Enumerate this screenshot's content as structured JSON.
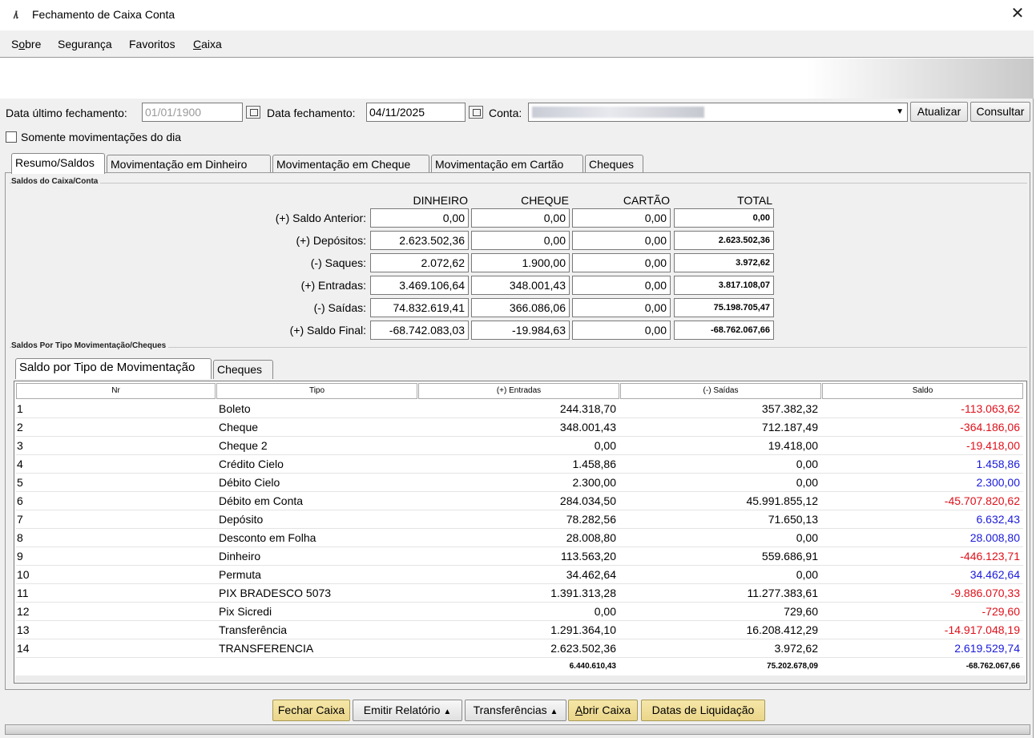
{
  "window": {
    "title": "Fechamento de Caixa Conta",
    "logo": "/\\."
  },
  "menu": [
    {
      "label": "Sobre",
      "underline": "o"
    },
    {
      "label": "Segurança"
    },
    {
      "label": "Favoritos"
    },
    {
      "label": "Caixa",
      "underline": "C"
    }
  ],
  "filters": {
    "data_ultimo_label": "Data último fechamento:",
    "data_ultimo_value": "01/01/1900",
    "data_fechamento_label": "Data fechamento:",
    "data_fechamento_value": "04/11/2025",
    "conta_label": "Conta:",
    "atualizar": "Atualizar",
    "consultar": "Consultar",
    "somente_label": "Somente movimentações do dia"
  },
  "tabs": [
    "Resumo/Saldos",
    "Movimentação em Dinheiro",
    "Movimentação em Cheque",
    "Movimentação em Cartão",
    "Cheques"
  ],
  "saldos": {
    "group_title": "Saldos do Caixa/Conta",
    "columns": [
      "DINHEIRO",
      "CHEQUE",
      "CARTÃO",
      "TOTAL"
    ],
    "rows": [
      {
        "label": "(+) Saldo Anterior:",
        "values": [
          "0,00",
          "0,00",
          "0,00",
          "0,00"
        ]
      },
      {
        "label": "(+) Depósitos:",
        "values": [
          "2.623.502,36",
          "0,00",
          "0,00",
          "2.623.502,36"
        ]
      },
      {
        "label": "(-) Saques:",
        "values": [
          "2.072,62",
          "1.900,00",
          "0,00",
          "3.972,62"
        ]
      },
      {
        "label": "(+) Entradas:",
        "values": [
          "3.469.106,64",
          "348.001,43",
          "0,00",
          "3.817.108,07"
        ]
      },
      {
        "label": "(-) Saídas:",
        "values": [
          "74.832.619,41",
          "366.086,06",
          "0,00",
          "75.198.705,47"
        ]
      },
      {
        "label": "(+) Saldo Final:",
        "values": [
          "-68.742.083,03",
          "-19.984,63",
          "0,00",
          "-68.762.067,66"
        ]
      }
    ]
  },
  "tipo": {
    "group_title": "Saldos Por Tipo Movimentação/Cheques",
    "subtabs": [
      "Saldo por Tipo de Movimentação",
      "Cheques"
    ],
    "headers": [
      "Nr",
      "Tipo",
      "(+) Entradas",
      "(-) Saídas",
      "Saldo"
    ],
    "rows": [
      {
        "nr": "1",
        "tipo": "Boleto",
        "entradas": "244.318,70",
        "saidas": "357.382,32",
        "saldo": "-113.063,62"
      },
      {
        "nr": "2",
        "tipo": "Cheque",
        "entradas": "348.001,43",
        "saidas": "712.187,49",
        "saldo": "-364.186,06"
      },
      {
        "nr": "3",
        "tipo": "Cheque 2",
        "entradas": "0,00",
        "saidas": "19.418,00",
        "saldo": "-19.418,00"
      },
      {
        "nr": "4",
        "tipo": "Crédito Cielo",
        "entradas": "1.458,86",
        "saidas": "0,00",
        "saldo": "1.458,86"
      },
      {
        "nr": "5",
        "tipo": "Débito Cielo",
        "entradas": "2.300,00",
        "saidas": "0,00",
        "saldo": "2.300,00"
      },
      {
        "nr": "6",
        "tipo": "Débito em Conta",
        "entradas": "284.034,50",
        "saidas": "45.991.855,12",
        "saldo": "-45.707.820,62"
      },
      {
        "nr": "7",
        "tipo": "Depósito",
        "entradas": "78.282,56",
        "saidas": "71.650,13",
        "saldo": "6.632,43"
      },
      {
        "nr": "8",
        "tipo": "Desconto em Folha",
        "entradas": "28.008,80",
        "saidas": "0,00",
        "saldo": "28.008,80"
      },
      {
        "nr": "9",
        "tipo": "Dinheiro",
        "entradas": "113.563,20",
        "saidas": "559.686,91",
        "saldo": "-446.123,71"
      },
      {
        "nr": "10",
        "tipo": "Permuta",
        "entradas": "34.462,64",
        "saidas": "0,00",
        "saldo": "34.462,64"
      },
      {
        "nr": "11",
        "tipo": "PIX BRADESCO 5073",
        "entradas": "1.391.313,28",
        "saidas": "11.277.383,61",
        "saldo": "-9.886.070,33"
      },
      {
        "nr": "12",
        "tipo": "Pix Sicredi",
        "entradas": "0,00",
        "saidas": "729,60",
        "saldo": "-729,60"
      },
      {
        "nr": "13",
        "tipo": "Transferência",
        "entradas": "1.291.364,10",
        "saidas": "16.208.412,29",
        "saldo": "-14.917.048,19"
      },
      {
        "nr": "14",
        "tipo": "TRANSFERENCIA",
        "entradas": "2.623.502,36",
        "saidas": "3.972,62",
        "saldo": "2.619.529,74"
      }
    ],
    "totals": {
      "entradas": "6.440.610,43",
      "saidas": "75.202.678,09",
      "saldo": "-68.762.067,66"
    }
  },
  "buttons": {
    "fechar": "Fechar Caixa",
    "emitir": "Emitir Relatório",
    "transferencias": "Transferências",
    "abrir": "Abrir Caixa",
    "abrir_underline": "A",
    "datas": "Datas de Liquidação"
  },
  "colors": {
    "negative": "#e0101a",
    "positive": "#1a1adc",
    "accent_button": "#ead58a"
  }
}
